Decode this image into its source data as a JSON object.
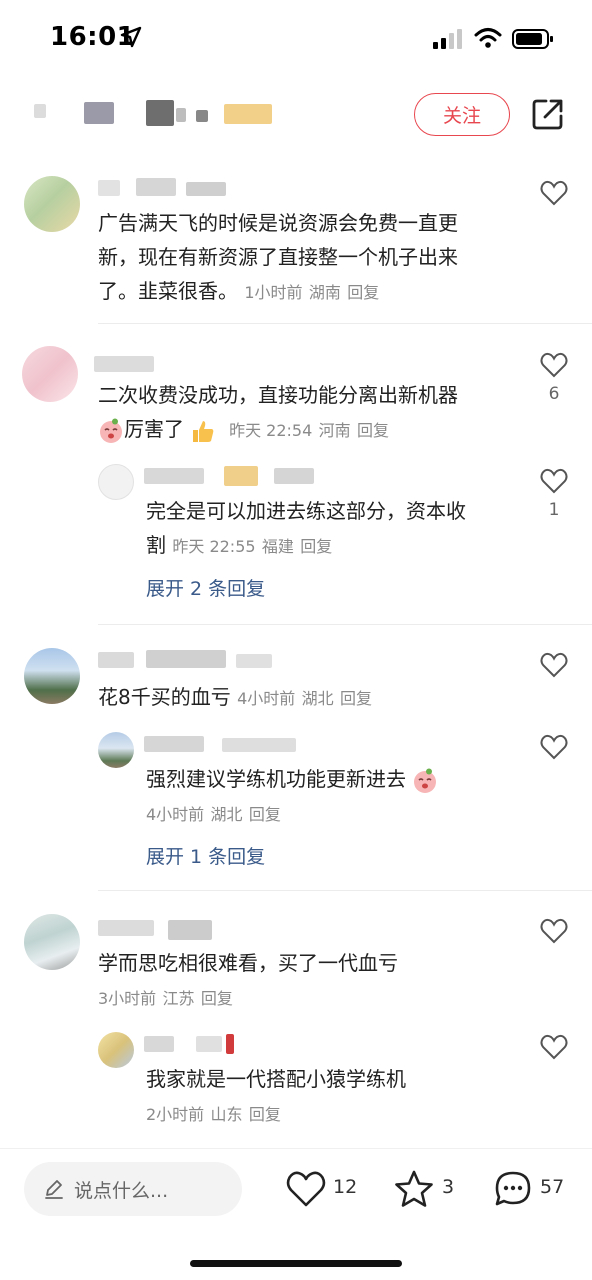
{
  "status_bar": {
    "time": "16:01"
  },
  "header": {
    "follow_label": "关注"
  },
  "comments": [
    {
      "text": "广告满天飞的时候是说资源会免费一直更新，现在有新资源了直接整一个机子出来了。韭菜很香。",
      "line1": "广告满天飞的时候是说资源会免费一直更",
      "line2": "新，现在有新资源了直接整一个机子出来",
      "line3": "了。韭菜很香。",
      "time": "1小时前",
      "location": "湖南",
      "reply": "回复"
    },
    {
      "line1": "二次收费没成功，直接功能分离出新机器",
      "line2": "厉害了",
      "time": "昨天 22:54",
      "location": "河南",
      "reply": "回复",
      "likes": "6",
      "sub": {
        "line1": "完全是可以加进去练这部分，资本收",
        "line2": "割",
        "time": "昨天 22:55",
        "location": "福建",
        "reply": "回复",
        "likes": "1"
      },
      "expand": "展开 2 条回复"
    },
    {
      "line1": "花8千买的血亏",
      "time": "4小时前",
      "location": "湖北",
      "reply": "回复",
      "sub": {
        "line1": "强烈建议学练机功能更新进去",
        "time": "4小时前",
        "location": "湖北",
        "reply": "回复"
      },
      "expand": "展开 1 条回复"
    },
    {
      "line1": "学而思吃相很难看，买了一代血亏",
      "time": "3小时前",
      "location": "江苏",
      "reply": "回复",
      "sub": {
        "line1": "我家就是一代搭配小猿学练机",
        "time": "2小时前",
        "location": "山东",
        "reply": "回复"
      }
    }
  ],
  "bottom_bar": {
    "placeholder": "说点什么...",
    "likes": "12",
    "stars": "3",
    "comments": "57"
  },
  "icons": {
    "location_arrow": "location-arrow-icon",
    "signal": "signal-icon",
    "wifi": "wifi-icon",
    "battery": "battery-icon",
    "share": "share-icon",
    "heart": "heart-icon",
    "star": "star-icon",
    "comment": "comment-bubble-icon",
    "pen": "pen-icon"
  },
  "colors": {
    "accent": "#e8474f",
    "link": "#3a5a8a",
    "meta": "#8a8a8a"
  }
}
